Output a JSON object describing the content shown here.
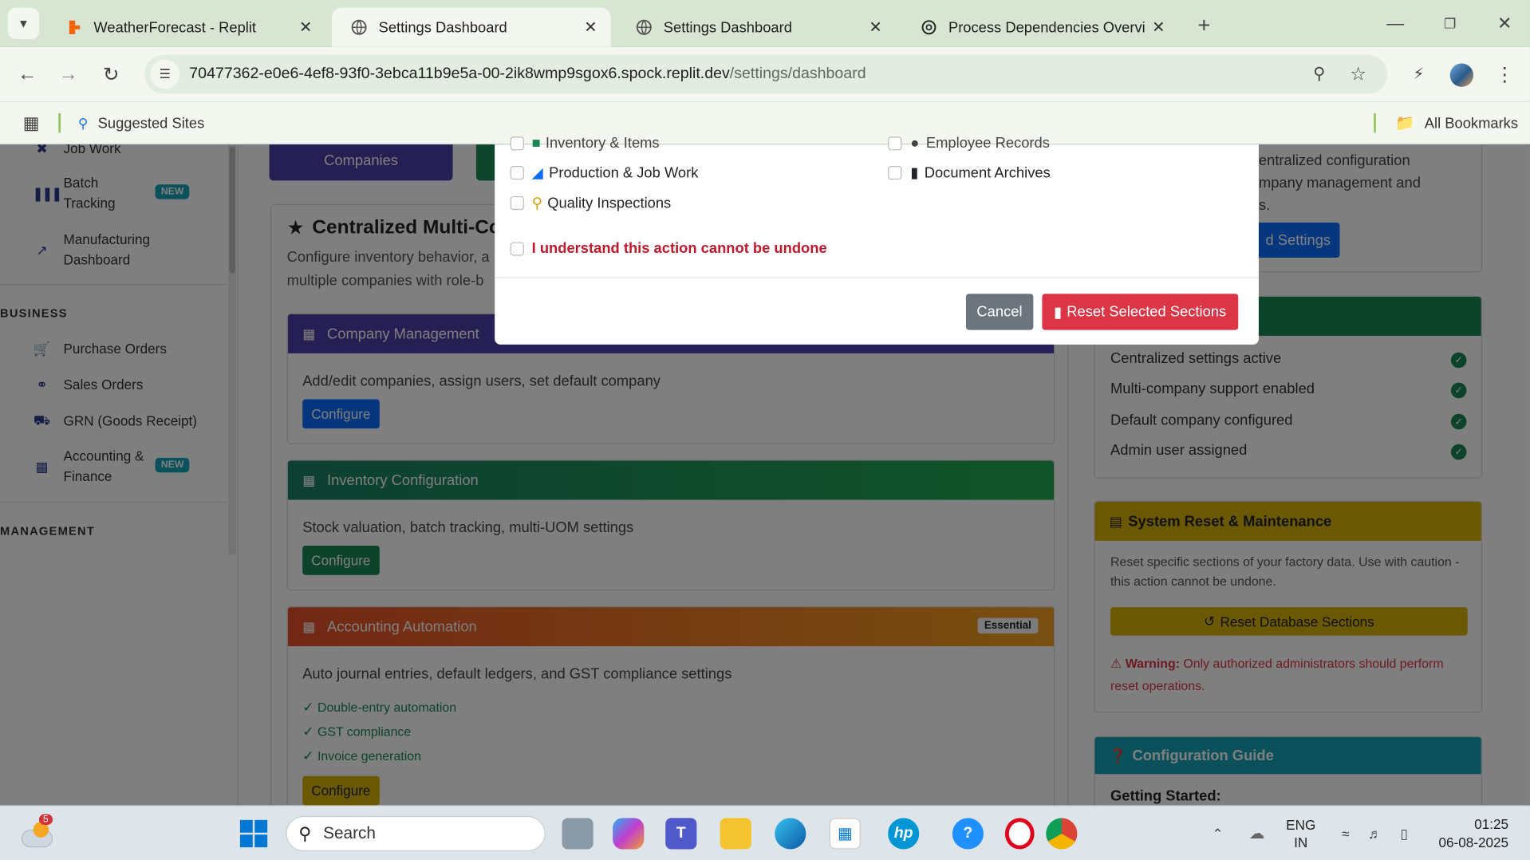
{
  "browser": {
    "tabs": [
      {
        "title": "WeatherForecast - Replit",
        "favicon": "replit-icon",
        "active": false
      },
      {
        "title": "Settings Dashboard",
        "favicon": "globe-icon",
        "active": true
      },
      {
        "title": "Settings Dashboard",
        "favicon": "globe-icon",
        "active": false
      },
      {
        "title": "Process Dependencies Overview",
        "favicon": "chatgpt-icon",
        "active": false
      }
    ],
    "url_host": "70477362-e0e6-4ef8-93f0-3ebca11b9e5a-00-2ik8wmp9sgox6.spock.replit.dev",
    "url_path": "/settings/dashboard",
    "bookmark_suggested": "Suggested Sites",
    "bookmark_all": "All Bookmarks"
  },
  "sidebar": {
    "items_top": [
      {
        "label": "Job Work",
        "icon": "tools-icon"
      },
      {
        "label": "Batch Tracking",
        "icon": "barcode-icon",
        "badge": "NEW"
      },
      {
        "label": "Manufacturing Dashboard",
        "icon": "chart-line-icon"
      }
    ],
    "business_heading": "BUSINESS",
    "business_items": [
      {
        "label": "Purchase Orders",
        "icon": "cart-icon"
      },
      {
        "label": "Sales Orders",
        "icon": "handshake-icon"
      },
      {
        "label": "GRN (Goods Receipt)",
        "icon": "truck-icon"
      },
      {
        "label": "Accounting & Finance",
        "icon": "calculator-icon",
        "badge": "NEW"
      }
    ],
    "management_heading": "MANAGEMENT"
  },
  "main": {
    "top_button": "Companies",
    "hero_title": "Centralized Multi-Co",
    "hero_desc_1": "Configure inventory behavior, a",
    "hero_desc_2": "multiple companies with role-b",
    "cards": [
      {
        "title": "Company Management",
        "desc": "Add/edit companies, assign users, set default company",
        "button": "Configure",
        "color": "#4b3fa8"
      },
      {
        "title": "Inventory Configuration",
        "desc": "Stock valuation, batch tracking, multi-UOM settings",
        "button": "Configure",
        "color": "#1a8a5a"
      },
      {
        "title": "Accounting Automation",
        "badge": "Essential",
        "desc": "Auto journal entries, default ledgers, and GST compliance settings",
        "features": [
          "Double-entry automation",
          "GST compliance",
          "Invoice generation"
        ],
        "button": "Configure",
        "color": "#e36a1a"
      }
    ]
  },
  "right": {
    "intro_1": "entralized configuration",
    "intro_2": "mpany management and",
    "intro_3": "s.",
    "intro_button": "d Settings",
    "status_items": [
      "Centralized settings active",
      "Multi-company support enabled",
      "Default company configured",
      "Admin user assigned"
    ],
    "reset_title": "System Reset & Maintenance",
    "reset_desc": "Reset specific sections of your factory data. Use with caution - this action cannot be undone.",
    "reset_button": "Reset Database Sections",
    "warning_strong": "Warning:",
    "warning_text": "Only authorized administrators should perform reset operations.",
    "guide_title": "Configuration Guide",
    "guide_sub": "Getting Started:"
  },
  "modal": {
    "partial_left": "Inventory & Items",
    "partial_right": "Employee Records",
    "options_left": [
      "Production & Job Work",
      "Quality Inspections"
    ],
    "options_right": [
      "Document Archives"
    ],
    "confirm": "I understand this action cannot be undone",
    "cancel": "Cancel",
    "reset": "Reset Selected Sections"
  },
  "taskbar": {
    "weather_badge": "5",
    "search_placeholder": "Search",
    "lang_1": "ENG",
    "lang_2": "IN",
    "time": "01:25",
    "date": "06-08-2025"
  },
  "colors": {
    "primary": "#0d6efd",
    "success": "#198754",
    "warning": "#d4b106",
    "danger": "#dc3545",
    "info": "#17a2b8"
  }
}
